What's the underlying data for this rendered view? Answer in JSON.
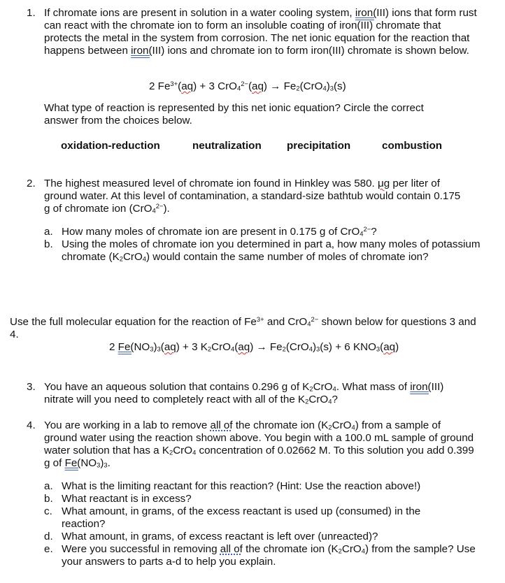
{
  "q1": {
    "number": "1.",
    "paragraph": [
      {
        "t": "If chromate ions are present in solution in a water cooling system, "
      },
      {
        "t": "iron(",
        "u": "dbl-blue"
      },
      {
        "t": "III) ions that form rust can react with the chromate ion to form an insoluble coating of iron(III) chromate that protects the metal in the system from corrosion.  The net ionic equation for the reaction that happens between "
      },
      {
        "t": "iron(",
        "u": "dbl-blue"
      },
      {
        "t": "III) ions and chromate ion to form iron(III) chromate is shown below."
      }
    ],
    "equation": [
      {
        "t": "2 Fe"
      },
      {
        "t": "3+",
        "s": "sup"
      },
      {
        "t": "("
      },
      {
        "t": "aq",
        "u": "wavy-red"
      },
      {
        "t": ") + 3 CrO"
      },
      {
        "t": "4",
        "s": "sub"
      },
      {
        "t": "2−",
        "s": "sup"
      },
      {
        "t": "("
      },
      {
        "t": "aq",
        "u": "wavy-red"
      },
      {
        "t": ") → Fe"
      },
      {
        "t": "2",
        "s": "sub"
      },
      {
        "t": "(CrO"
      },
      {
        "t": "4",
        "s": "sub"
      },
      {
        "t": ")"
      },
      {
        "t": "3",
        "s": "sub"
      },
      {
        "t": "(s)"
      }
    ],
    "question": "What type of reaction is represented by this net ionic equation? Circle the correct answer from the choices below.",
    "choices": [
      "oxidation-reduction",
      "neutralization",
      "precipitation",
      "combustion"
    ]
  },
  "q2": {
    "number": "2.",
    "paragraph": [
      {
        "t": "The highest measured level of chromate ion found in Hinkley was 580. "
      },
      {
        "t": "μg",
        "u": "wavy-red"
      },
      {
        "t": " per liter of ground water. At this level of contamination, a standard-size bathtub would contain 0.175 g of chromate ion (CrO"
      },
      {
        "t": "4",
        "s": "sub"
      },
      {
        "t": "2−",
        "s": "sup"
      },
      {
        "t": ")."
      }
    ],
    "parts": [
      {
        "label": "a.",
        "text": [
          {
            "t": "How many moles of chromate ion are present in 0.175 g of CrO"
          },
          {
            "t": "4",
            "s": "sub"
          },
          {
            "t": "2−",
            "s": "sup"
          },
          {
            "t": "?"
          }
        ]
      },
      {
        "label": "b.",
        "text": [
          {
            "t": "Using the moles of chromate ion you determined in part a, how many moles of potassium chromate (K"
          },
          {
            "t": "2",
            "s": "sub"
          },
          {
            "t": "CrO"
          },
          {
            "t": "4",
            "s": "sub"
          },
          {
            "t": ") would contain the same number of moles of chromate ion?"
          }
        ]
      }
    ]
  },
  "intro34": {
    "paragraph": [
      {
        "t": "Use the full molecular equation for the reaction of Fe"
      },
      {
        "t": "3+",
        "s": "sup"
      },
      {
        "t": " and CrO"
      },
      {
        "t": "4",
        "s": "sub"
      },
      {
        "t": "2−",
        "s": "sup"
      },
      {
        "t": " shown below for questions 3 and 4."
      }
    ],
    "equation": [
      {
        "t": "2 "
      },
      {
        "t": "Fe(",
        "u": "dbl-blue"
      },
      {
        "t": "NO"
      },
      {
        "t": "3",
        "s": "sub"
      },
      {
        "t": ")"
      },
      {
        "t": "3",
        "s": "sub"
      },
      {
        "t": "("
      },
      {
        "t": "aq",
        "u": "wavy-red"
      },
      {
        "t": ") + 3 K"
      },
      {
        "t": "2",
        "s": "sub"
      },
      {
        "t": "CrO"
      },
      {
        "t": "4",
        "s": "sub"
      },
      {
        "t": "("
      },
      {
        "t": "aq",
        "u": "wavy-red"
      },
      {
        "t": ") → Fe"
      },
      {
        "t": "2",
        "s": "sub"
      },
      {
        "t": "(CrO"
      },
      {
        "t": "4",
        "s": "sub"
      },
      {
        "t": ")"
      },
      {
        "t": "3",
        "s": "sub"
      },
      {
        "t": "(s) + 6 KNO"
      },
      {
        "t": "3",
        "s": "sub"
      },
      {
        "t": "("
      },
      {
        "t": "aq",
        "u": "wavy-red"
      },
      {
        "t": ")"
      }
    ]
  },
  "q3": {
    "number": "3.",
    "paragraph": [
      {
        "t": "You have an aqueous solution that contains 0.296 g of K"
      },
      {
        "t": "2",
        "s": "sub"
      },
      {
        "t": "CrO"
      },
      {
        "t": "4",
        "s": "sub"
      },
      {
        "t": ". What mass of "
      },
      {
        "t": "iron(",
        "u": "dbl-blue"
      },
      {
        "t": "III) nitrate will you need to completely react with all of the K"
      },
      {
        "t": "2",
        "s": "sub"
      },
      {
        "t": "CrO"
      },
      {
        "t": "4",
        "s": "sub"
      },
      {
        "t": "?"
      }
    ]
  },
  "q4": {
    "number": "4.",
    "paragraph": [
      {
        "t": "You are working in a lab to remove "
      },
      {
        "t": "all of",
        "u": "dot-blue"
      },
      {
        "t": " the chromate ion (K"
      },
      {
        "t": "2",
        "s": "sub"
      },
      {
        "t": "CrO"
      },
      {
        "t": "4",
        "s": "sub"
      },
      {
        "t": ") from a sample of ground water using the reaction shown above. You begin with a 100.0 mL sample of ground water solution that has a K"
      },
      {
        "t": "2",
        "s": "sub"
      },
      {
        "t": "CrO"
      },
      {
        "t": "4",
        "s": "sub"
      },
      {
        "t": " concentration of 0.02662 M.  To this solution you add 0.399 g of "
      },
      {
        "t": "Fe(",
        "u": "dbl-blue"
      },
      {
        "t": "NO"
      },
      {
        "t": "3",
        "s": "sub"
      },
      {
        "t": ")"
      },
      {
        "t": "3",
        "s": "sub"
      },
      {
        "t": "."
      }
    ],
    "parts": [
      {
        "label": "a.",
        "text": [
          {
            "t": "What is the limiting reactant for this reaction? (Hint: Use the reaction above!)"
          }
        ]
      },
      {
        "label": "b.",
        "text": [
          {
            "t": "What reactant is in excess?"
          }
        ]
      },
      {
        "label": "c.",
        "text": [
          {
            "t": "What amount, in grams, of the excess reactant is used up (consumed) in the reaction?"
          }
        ]
      },
      {
        "label": "d.",
        "text": [
          {
            "t": "What amount, in grams, of excess reactant is left over (unreacted)?"
          }
        ]
      },
      {
        "label": "e.",
        "text": [
          {
            "t": "Were you successful in removing "
          },
          {
            "t": "all of",
            "u": "dot-blue"
          },
          {
            "t": " the chromate ion (K"
          },
          {
            "t": "2",
            "s": "sub"
          },
          {
            "t": "CrO"
          },
          {
            "t": "4",
            "s": "sub"
          },
          {
            "t": ") from the sample? Use your answers to parts a-d to help you explain."
          }
        ]
      }
    ]
  }
}
